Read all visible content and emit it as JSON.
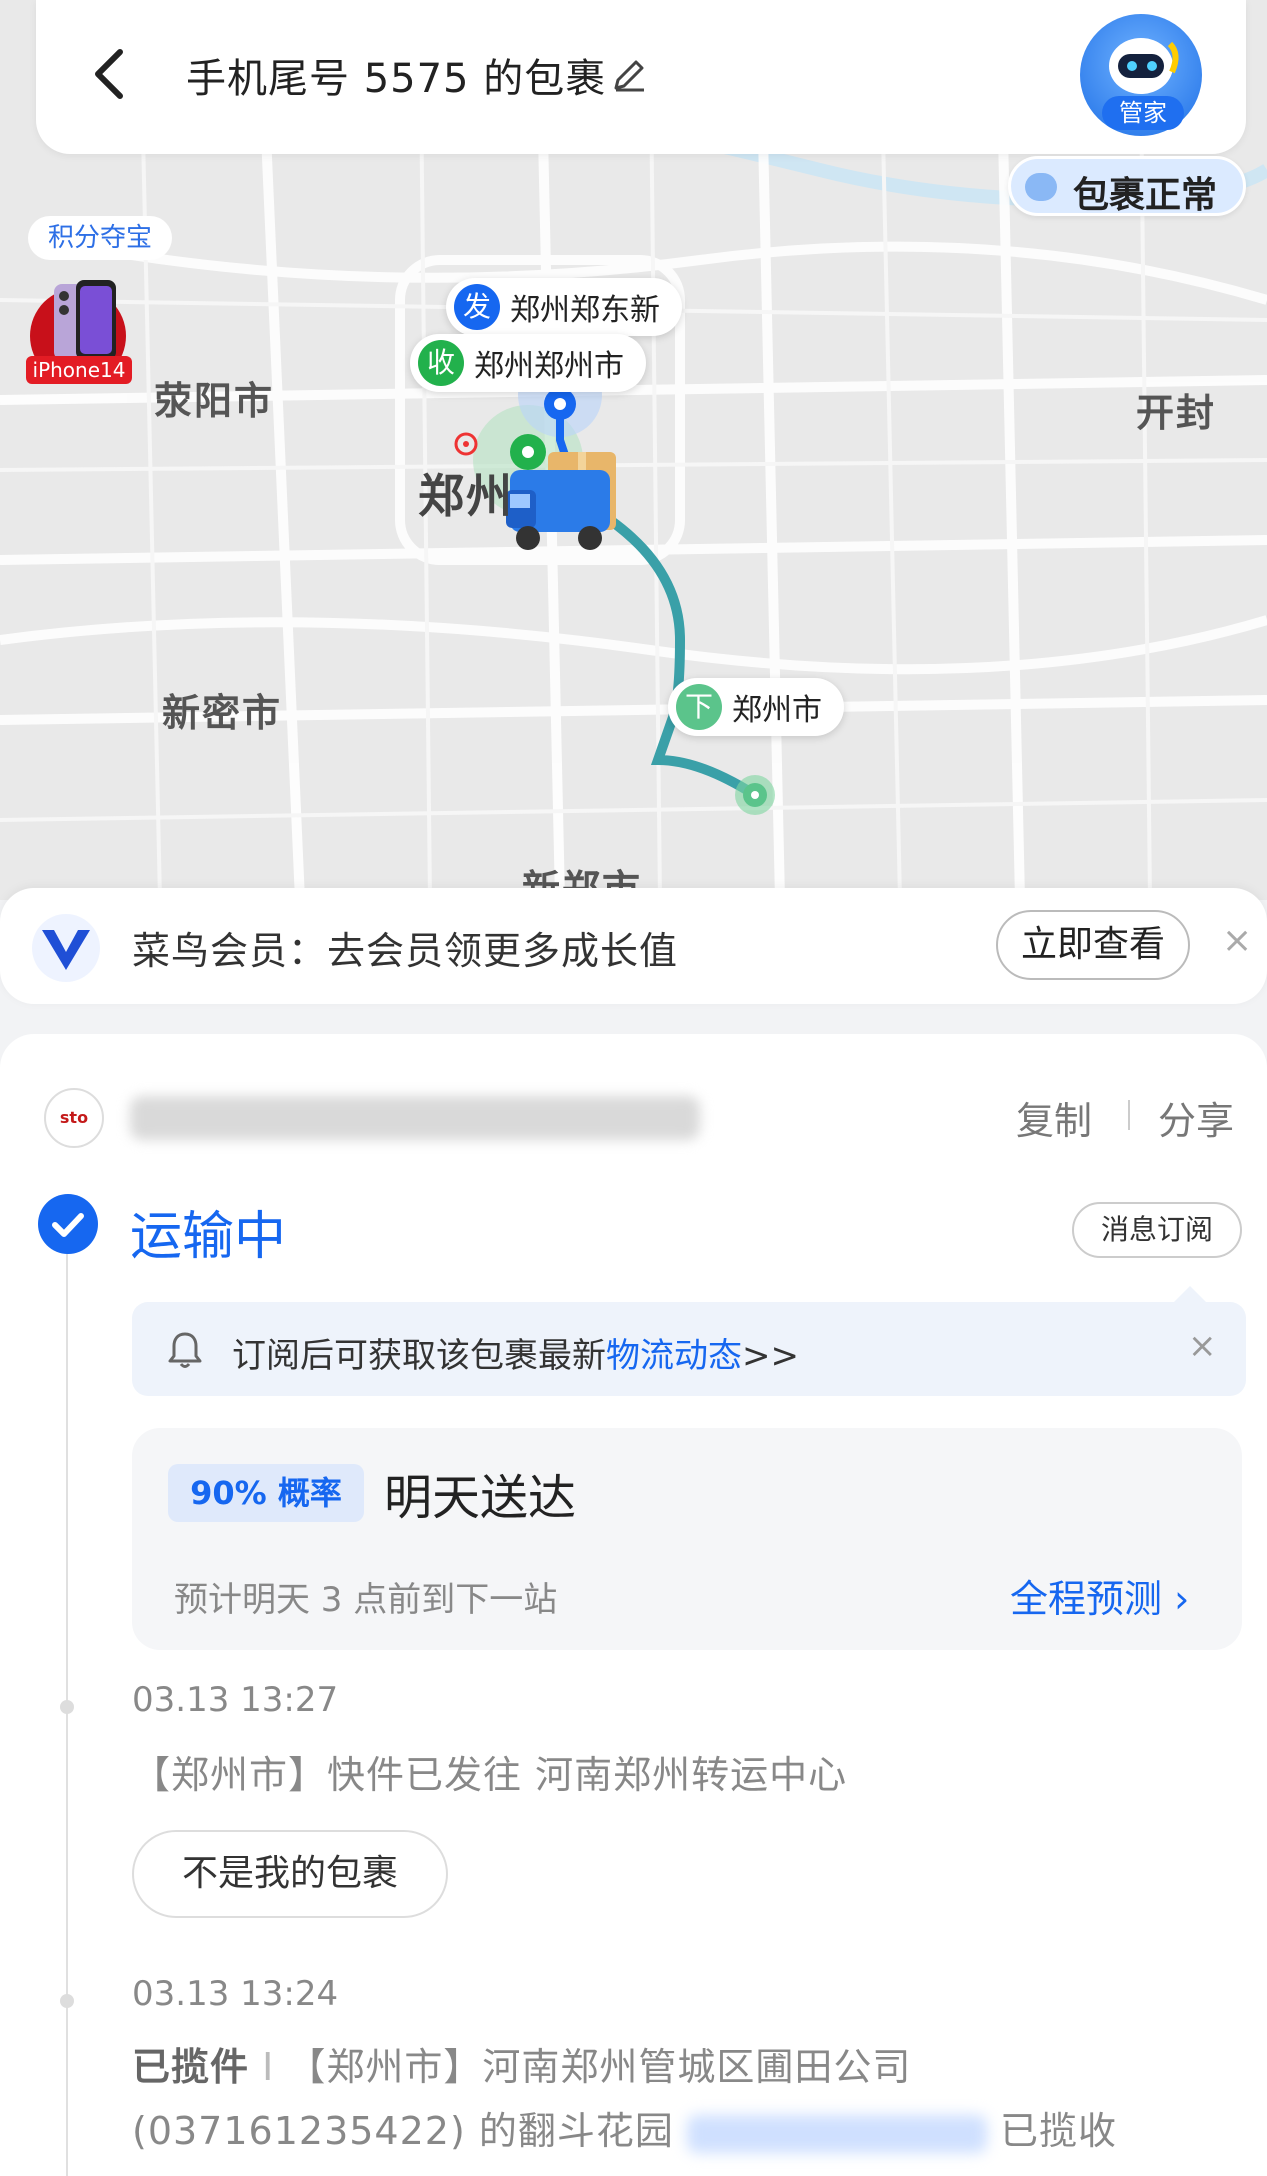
{
  "header": {
    "title": "手机尾号 5575 的包裹"
  },
  "assistant": {
    "tag": "管家",
    "status": "包裹正常"
  },
  "promo": {
    "badge": "积分夺宝",
    "phone_label": "iPhone14"
  },
  "map": {
    "cities": [
      "荥阳市",
      "郑州",
      "开封",
      "新密市",
      "新郑市"
    ],
    "markers": [
      {
        "badge": "发",
        "label": "郑州郑东新",
        "color": "#1667f0"
      },
      {
        "badge": "收",
        "label": "郑州郑州市",
        "color": "#22b14c"
      },
      {
        "badge": "下",
        "label": "郑州市",
        "color": "#5bc48b"
      }
    ]
  },
  "member": {
    "text": "菜鸟会员：去会员领更多成长值",
    "button": "立即查看",
    "close": "×"
  },
  "package": {
    "courier_logo": "sto",
    "copy": "复制",
    "share": "分享",
    "status": "运输中",
    "subscribe": "消息订阅",
    "notice_prefix": "订阅后可获取该包裹最新",
    "notice_link": "物流动态",
    "notice_suffix": ">>",
    "notice_close": "×"
  },
  "prediction": {
    "probability": "90% 概率",
    "title": "明天送达",
    "subtitle": "预计明天 3 点前到下一站",
    "link": "全程预测 ›"
  },
  "timeline": [
    {
      "time": "03.13 13:27",
      "text": "【郑州市】快件已发往 河南郑州转运中心",
      "action": "不是我的包裹"
    },
    {
      "time": "03.13 13:24",
      "label": "已揽件",
      "text": "【郑州市】河南郑州管城区圃田公司",
      "text2_prefix": "(037161235422) 的翻斗花园",
      "text2_suffix": "已揽收"
    }
  ],
  "colors": {
    "accent": "#1667f0",
    "route": "#3aa0a8",
    "green": "#22b14c"
  }
}
